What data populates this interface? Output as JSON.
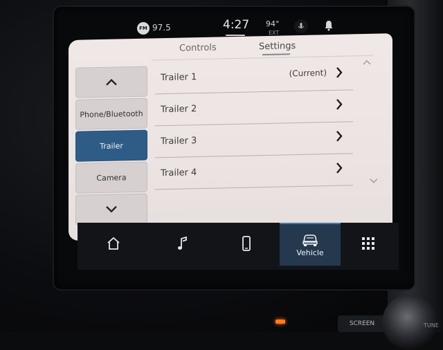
{
  "status_bar": {
    "radio_badge": "FM",
    "radio_freq": "97.5",
    "clock": "4:27",
    "temperature": "94°",
    "temperature_label": "EXT",
    "icons": [
      "voice-command-icon",
      "bell-icon"
    ]
  },
  "tabs": [
    {
      "label": "Controls",
      "active": false
    },
    {
      "label": "Settings",
      "active": true
    }
  ],
  "sidebar": {
    "items": [
      {
        "label": "",
        "icon": "chevron-up-icon"
      },
      {
        "label": "Phone/Bluetooth",
        "selected": false
      },
      {
        "label": "Trailer",
        "selected": true
      },
      {
        "label": "Camera",
        "selected": false
      },
      {
        "label": "",
        "icon": "chevron-down-icon"
      }
    ]
  },
  "trailers": [
    {
      "label": "Trailer 1",
      "status": "(Current)"
    },
    {
      "label": "Trailer 2",
      "status": ""
    },
    {
      "label": "Trailer 3",
      "status": ""
    },
    {
      "label": "Trailer 4",
      "status": ""
    }
  ],
  "nav": {
    "items": [
      {
        "icon": "home-icon",
        "label": ""
      },
      {
        "icon": "music-note-icon",
        "label": ""
      },
      {
        "icon": "phone-icon",
        "label": ""
      },
      {
        "icon": "vehicle-icon",
        "label": "Vehicle",
        "active": true
      },
      {
        "icon": "apps-grid-icon",
        "label": ""
      }
    ]
  },
  "hardware": {
    "screen_button": "SCREEN",
    "tune_label": "TUNE"
  },
  "colors": {
    "accent": "#2f5c86",
    "panel_bg": "#ede5e3",
    "nav_active": "#24394e"
  }
}
